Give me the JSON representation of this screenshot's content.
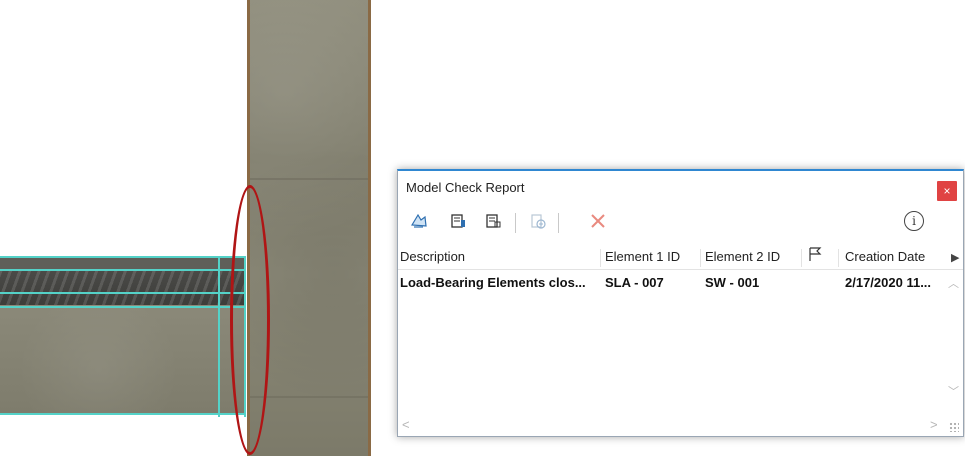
{
  "dialog": {
    "title": "Model Check Report",
    "close_label": "×",
    "info_label": "i"
  },
  "toolbar": {
    "buttons": [
      {
        "icon": "select-elements-icon"
      },
      {
        "icon": "element-1-icon"
      },
      {
        "icon": "element-2-icon"
      },
      {
        "icon": "add-to-issue-icon",
        "disabled": true
      },
      {
        "icon": "delete-icon"
      }
    ]
  },
  "table": {
    "columns": [
      "Description",
      "Element 1 ID",
      "Element 2 ID",
      "",
      "Creation Date"
    ],
    "rows": [
      {
        "description": "Load-Bearing Elements clos...",
        "element1": "SLA - 007",
        "element2": "SW - 001",
        "flag": "",
        "date": "2/17/2020 11..."
      }
    ]
  },
  "colors": {
    "accent": "#2f87d1",
    "close": "#e04343",
    "highlight_ellipse": "#b01515",
    "selection_outline": "#54d2c8"
  }
}
